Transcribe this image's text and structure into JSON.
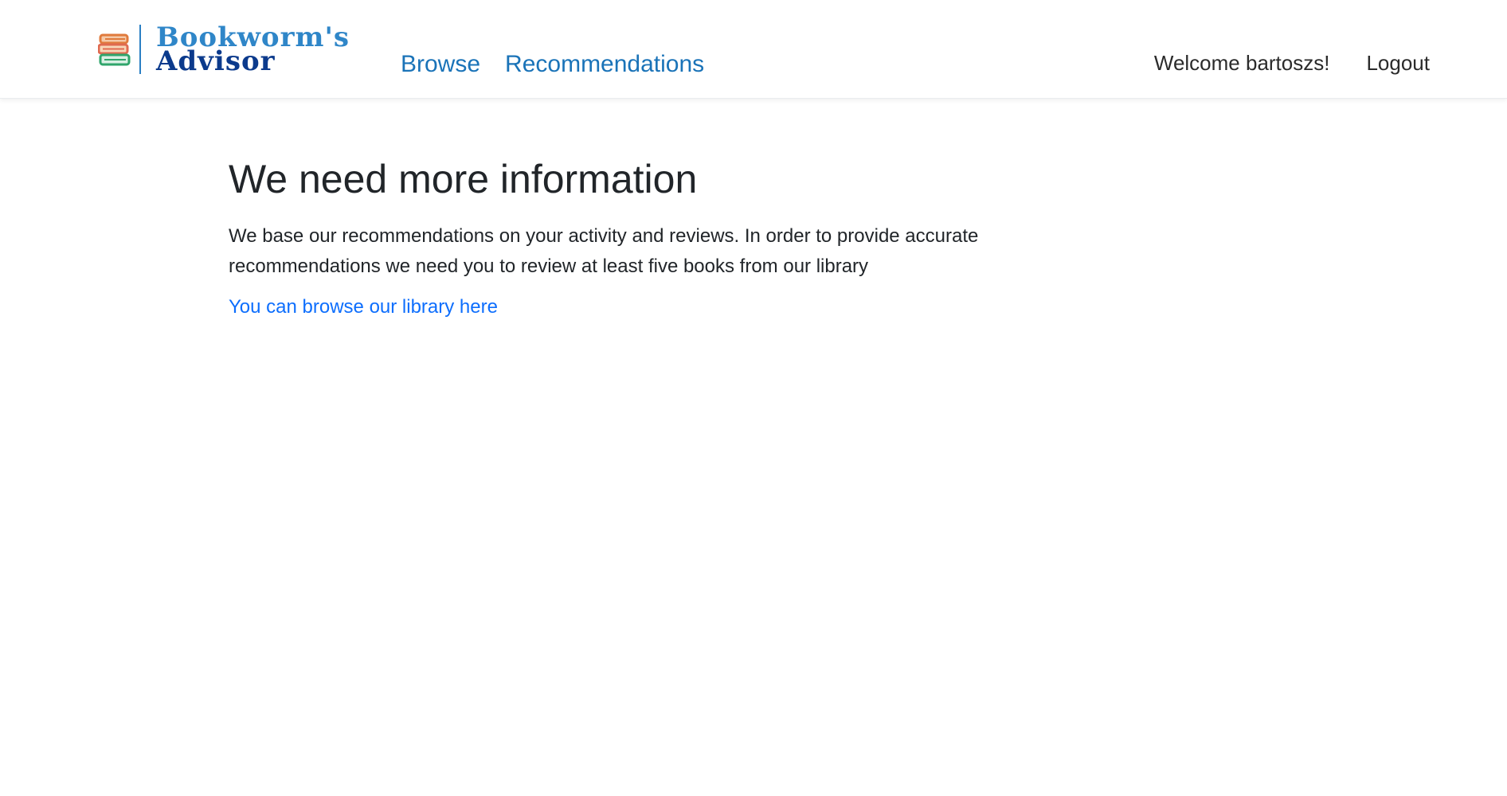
{
  "brand": {
    "line1": "Bookworm's",
    "line2": "Advisor"
  },
  "nav": {
    "browse": "Browse",
    "recommendations": "Recommendations"
  },
  "user": {
    "welcome": "Welcome bartoszs!",
    "logout": "Logout"
  },
  "main": {
    "title": "We need more information",
    "description": "We base our recommendations on your activity and reviews. In order to provide accurate recommendations we need you to review at least five books from our library",
    "browse_link": "You can browse our library here"
  },
  "colors": {
    "link": "#1a73b8",
    "brand_light": "#2f86c8",
    "brand_dark": "#0b3a8c",
    "text": "#212529",
    "body_link": "#0d6efd"
  },
  "icons": {
    "logo": "book-stack-icon"
  }
}
